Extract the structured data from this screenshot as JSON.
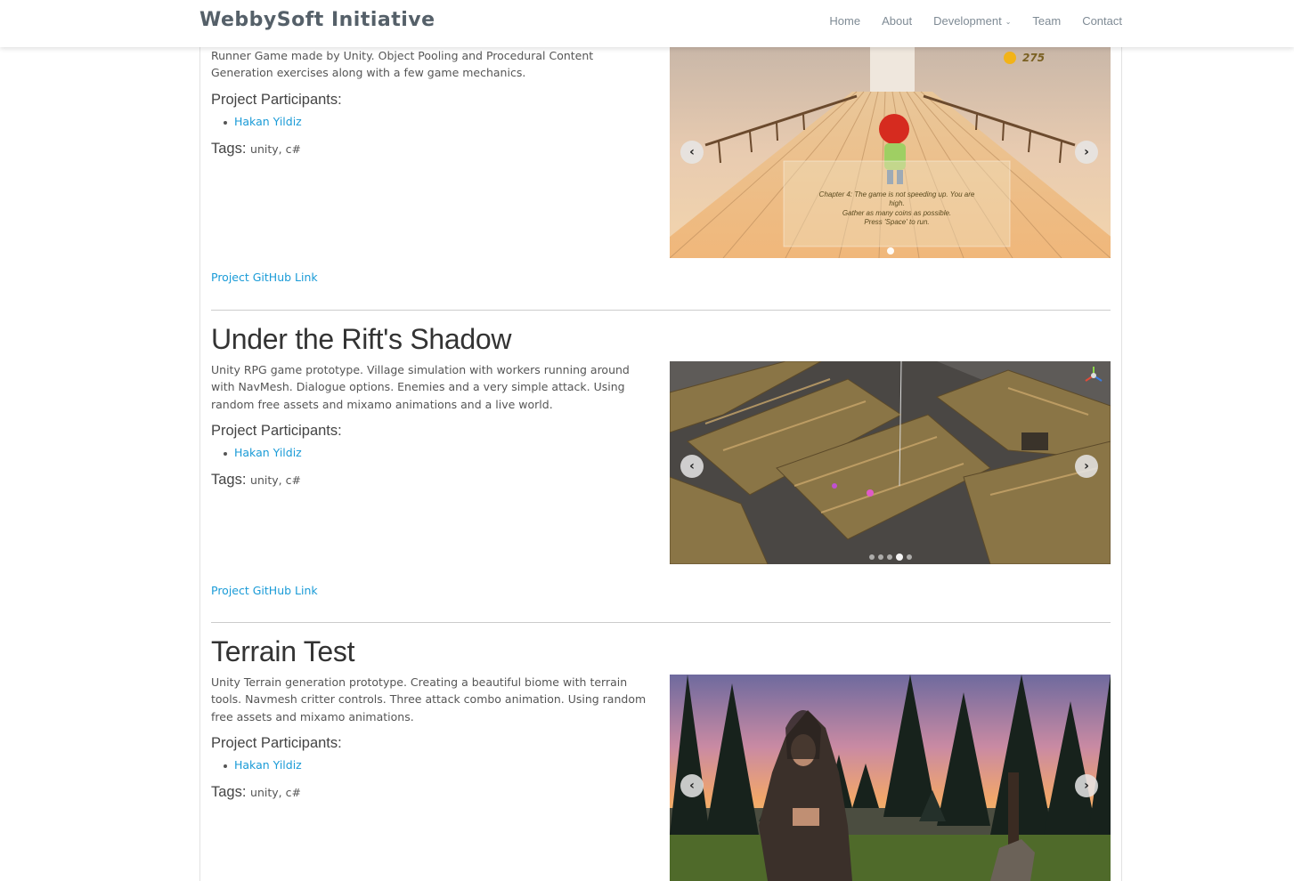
{
  "site": {
    "brand": "WebbySoft Initiative",
    "nav": [
      {
        "label": "Home"
      },
      {
        "label": "About"
      },
      {
        "label": "Development"
      },
      {
        "label": "Team"
      },
      {
        "label": "Contact"
      }
    ]
  },
  "projects": [
    {
      "title": "",
      "description": "Runner Game made by Unity. Object Pooling and Procedural Content Generation exercises along with a few game mechanics.",
      "participants_heading": "Project Participants:",
      "participants": [
        "Hakan Yildiz"
      ],
      "tags_label": "Tags:",
      "tags": "unity, c#",
      "link": "Project GitHub Link",
      "slide": {
        "coin_count": "275",
        "caption_line1": "Chapter 4: The game is not speeding up. You are",
        "caption_line2": "high.",
        "caption_line3": "Gather as many coins as possible.",
        "caption_line4": "Press 'Space' to run."
      }
    },
    {
      "title": "Under the Rift's Shadow",
      "description": "Unity RPG game prototype. Village simulation with workers running around with NavMesh. Dialogue options. Enemies and a very simple attack. Using random free assets and mixamo animations and a live world.",
      "participants_heading": "Project Participants:",
      "participants": [
        "Hakan Yildiz"
      ],
      "tags_label": "Tags:",
      "tags": "unity, c#",
      "link": "Project GitHub Link"
    },
    {
      "title": "Terrain Test",
      "description": "Unity Terrain generation prototype. Creating a beautiful biome with terrain tools. Navmesh critter controls. Three attack combo animation. Using random free assets and mixamo animations.",
      "participants_heading": "Project Participants:",
      "participants": [
        "Hakan Yildiz"
      ],
      "tags_label": "Tags:",
      "tags": "unity, c#",
      "link": "Project GitHub Link"
    }
  ],
  "colors": {
    "link": "#1a9bd7",
    "brand": "#556069",
    "nav": "#7f8b95"
  },
  "icons": {
    "prev": "chevron-left-icon",
    "next": "chevron-right-icon",
    "dropdown": "chevron-down-icon",
    "coin": "coin-icon"
  }
}
